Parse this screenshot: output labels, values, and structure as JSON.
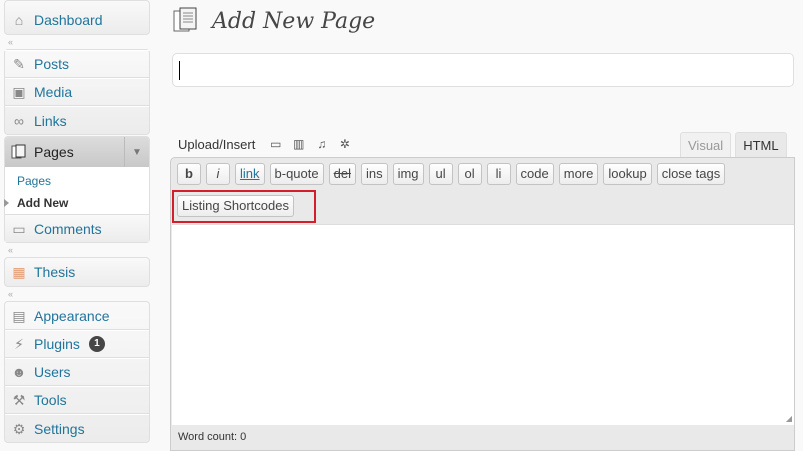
{
  "sidebar": {
    "dashboard": "Dashboard",
    "posts": "Posts",
    "media": "Media",
    "links": "Links",
    "pages": "Pages",
    "pages_sub": [
      "Pages",
      "Add New"
    ],
    "comments": "Comments",
    "thesis": "Thesis",
    "appearance": "Appearance",
    "plugins": "Plugins",
    "plugins_badge": "1",
    "users": "Users",
    "tools": "Tools",
    "settings": "Settings"
  },
  "page": {
    "title": "Add New Page",
    "title_input_value": ""
  },
  "media": {
    "label": "Upload/Insert"
  },
  "tabs": [
    "Visual",
    "HTML"
  ],
  "active_tab": "HTML",
  "quicktags": [
    "b",
    "i",
    "link",
    "b-quote",
    "del",
    "ins",
    "img",
    "ul",
    "ol",
    "li",
    "code",
    "more",
    "lookup",
    "close tags"
  ],
  "extra_button": "Listing Shortcodes",
  "word_count": "Word count: 0",
  "colors": {
    "link": "#21759b",
    "highlight": "#d21f2b"
  }
}
